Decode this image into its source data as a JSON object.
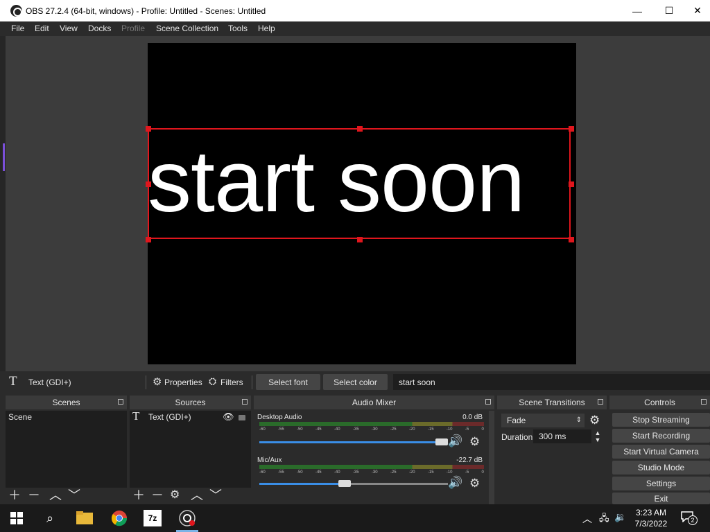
{
  "window": {
    "title": "OBS 27.2.4 (64-bit, windows) - Profile: Untitled - Scenes: Untitled",
    "minimize_glyph": "—",
    "maximize_glyph": "☐",
    "close_glyph": "✕"
  },
  "menu": [
    "File",
    "Edit",
    "View",
    "Docks",
    "Profile",
    "Scene Collection",
    "Tools",
    "Help"
  ],
  "preview": {
    "text": "start soon"
  },
  "properties_bar": {
    "source_icon": "T",
    "source_name": "Text (GDI+)",
    "properties_label": "Properties",
    "filters_label": "Filters",
    "select_font_label": "Select font",
    "select_color_label": "Select color",
    "text_value": "start soon"
  },
  "scenes": {
    "title": "Scenes",
    "items": [
      "Scene"
    ]
  },
  "sources": {
    "title": "Sources",
    "items": [
      {
        "icon": "T",
        "name": "Text (GDI+)"
      }
    ]
  },
  "audio_mixer": {
    "title": "Audio Mixer",
    "tick_labels": [
      "-60",
      "-55",
      "-50",
      "-45",
      "-40",
      "-35",
      "-30",
      "-25",
      "-20",
      "-15",
      "-10",
      "-5",
      "0"
    ],
    "channels": [
      {
        "name": "Desktop Audio",
        "db": "0.0 dB",
        "volume": 1.0
      },
      {
        "name": "Mic/Aux",
        "db": "-22.7 dB",
        "volume": 0.45
      }
    ]
  },
  "scene_transitions": {
    "title": "Scene Transitions",
    "transition": "Fade",
    "duration_label": "Duration",
    "duration_value": "300 ms"
  },
  "controls": {
    "title": "Controls",
    "buttons": [
      "Stop Streaming",
      "Start Recording",
      "Start Virtual Camera",
      "Studio Mode",
      "Settings",
      "Exit"
    ]
  },
  "taskbar": {
    "time": "3:23 AM",
    "date": "7/3/2022",
    "notification_count": "2",
    "app_7z_label": "7z"
  },
  "colors": {
    "selection": "#e0161d",
    "accent": "#3a8ee6"
  }
}
